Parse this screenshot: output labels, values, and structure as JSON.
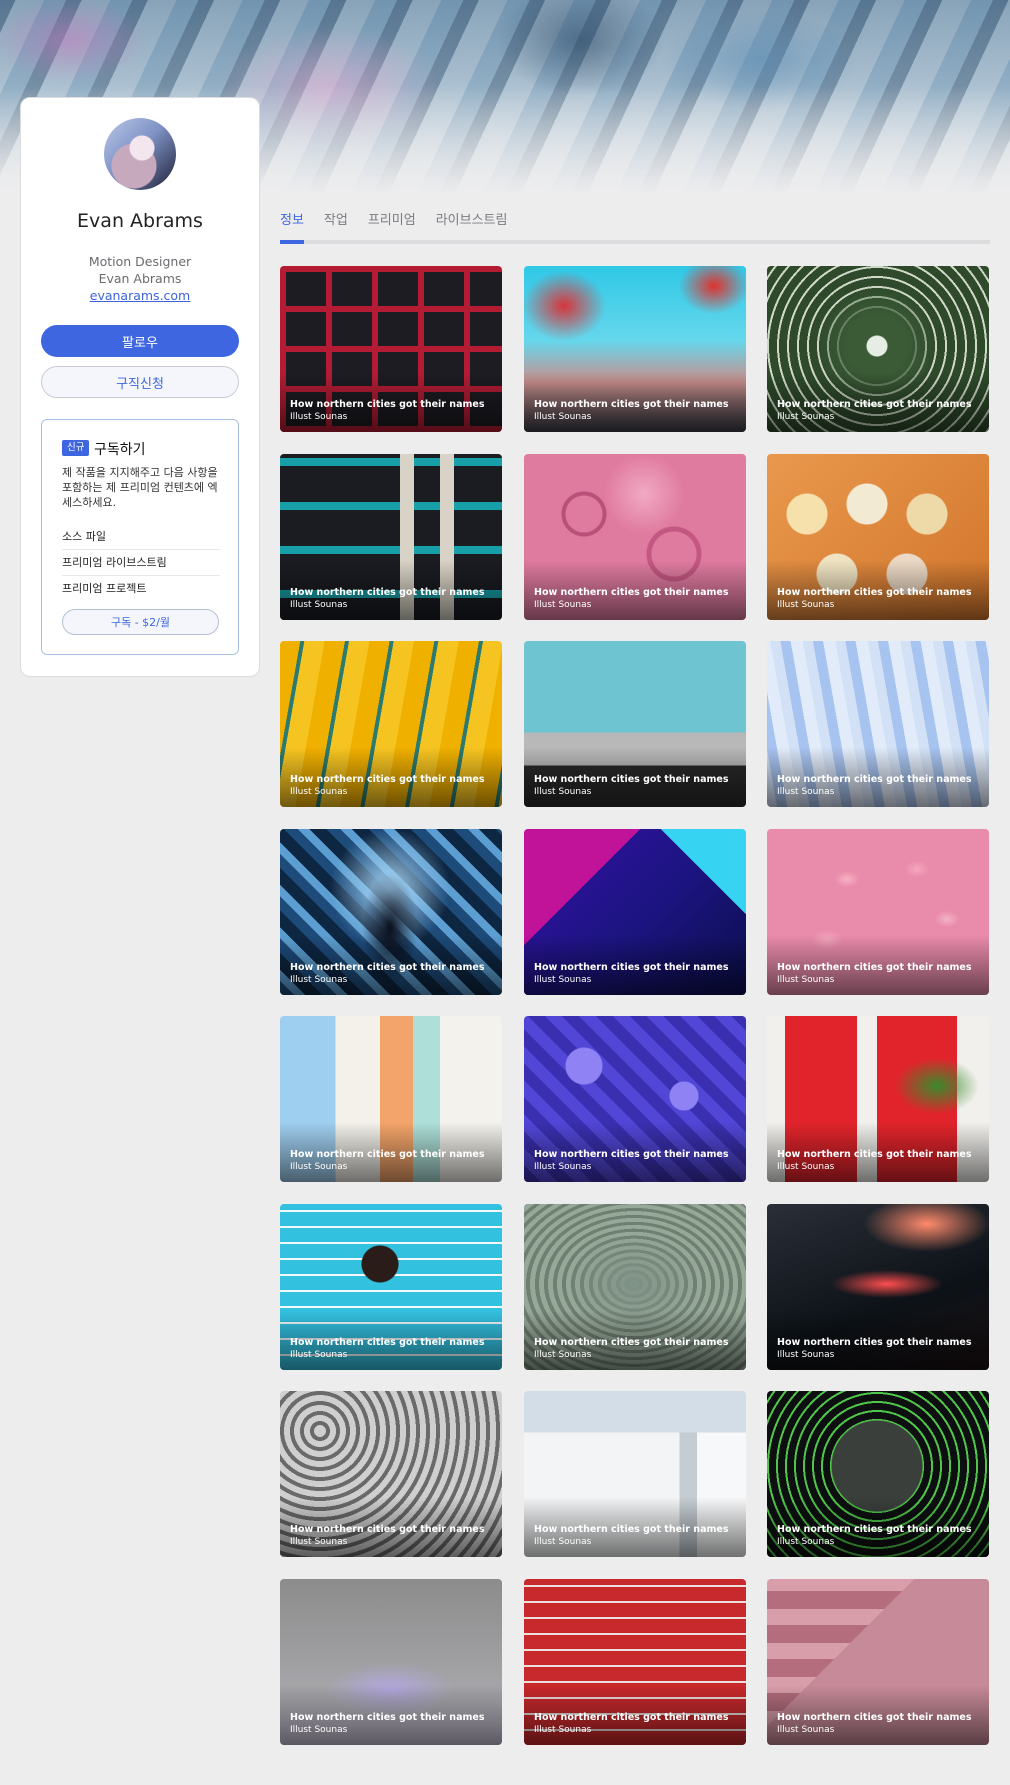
{
  "profile": {
    "name": "Evan Abrams",
    "role": "Motion Designer",
    "subname": "Evan Abrams",
    "website": "evanarams.com",
    "follow_label": "팔로우",
    "hire_label": "구직신청"
  },
  "subscription": {
    "badge": "신규",
    "title": "구독하기",
    "description": "제 작품을 지지해주고 다음 사항을 포함하는 제 프리미엄 컨텐츠에 엑세스하세요.",
    "items": [
      "소스 파일",
      "프리미엄 라이브스트림",
      "프리미엄 프로젝트"
    ],
    "button_label": "구독 - $2/월"
  },
  "tabs": [
    {
      "label": "정보",
      "active": true
    },
    {
      "label": "작업",
      "active": false
    },
    {
      "label": "프리미엄",
      "active": false
    },
    {
      "label": "라이브스트림",
      "active": false
    }
  ],
  "projects": [
    {
      "title": "How northern cities got their names",
      "author": "Illust Sounas"
    },
    {
      "title": "How northern cities got their names",
      "author": "Illust Sounas"
    },
    {
      "title": "How northern cities got their names",
      "author": "Illust Sounas"
    },
    {
      "title": "How northern cities got their names",
      "author": "Illust Sounas"
    },
    {
      "title": "How northern cities got their names",
      "author": "Illust Sounas"
    },
    {
      "title": "How northern cities got their names",
      "author": "Illust Sounas"
    },
    {
      "title": "How northern cities got their names",
      "author": "Illust Sounas"
    },
    {
      "title": "How northern cities got their names",
      "author": "Illust Sounas"
    },
    {
      "title": "How northern cities got their names",
      "author": "Illust Sounas"
    },
    {
      "title": "How northern cities got their names",
      "author": "Illust Sounas"
    },
    {
      "title": "How northern cities got their names",
      "author": "Illust Sounas"
    },
    {
      "title": "How northern cities got their names",
      "author": "Illust Sounas"
    },
    {
      "title": "How northern cities got their names",
      "author": "Illust Sounas"
    },
    {
      "title": "How northern cities got their names",
      "author": "Illust Sounas"
    },
    {
      "title": "How northern cities got their names",
      "author": "Illust Sounas"
    },
    {
      "title": "How northern cities got their names",
      "author": "Illust Sounas"
    },
    {
      "title": "How northern cities got their names",
      "author": "Illust Sounas"
    },
    {
      "title": "How northern cities got their names",
      "author": "Illust Sounas"
    },
    {
      "title": "How northern cities got their names",
      "author": "Illust Sounas"
    },
    {
      "title": "How northern cities got their names",
      "author": "Illust Sounas"
    },
    {
      "title": "How northern cities got their names",
      "author": "Illust Sounas"
    },
    {
      "title": "How northern cities got their names",
      "author": "Illust Sounas"
    },
    {
      "title": "How northern cities got their names",
      "author": "Illust Sounas"
    },
    {
      "title": "How northern cities got their names",
      "author": "Illust Sounas"
    }
  ],
  "colors": {
    "accent": "#3e66e0",
    "background": "#ededee"
  }
}
